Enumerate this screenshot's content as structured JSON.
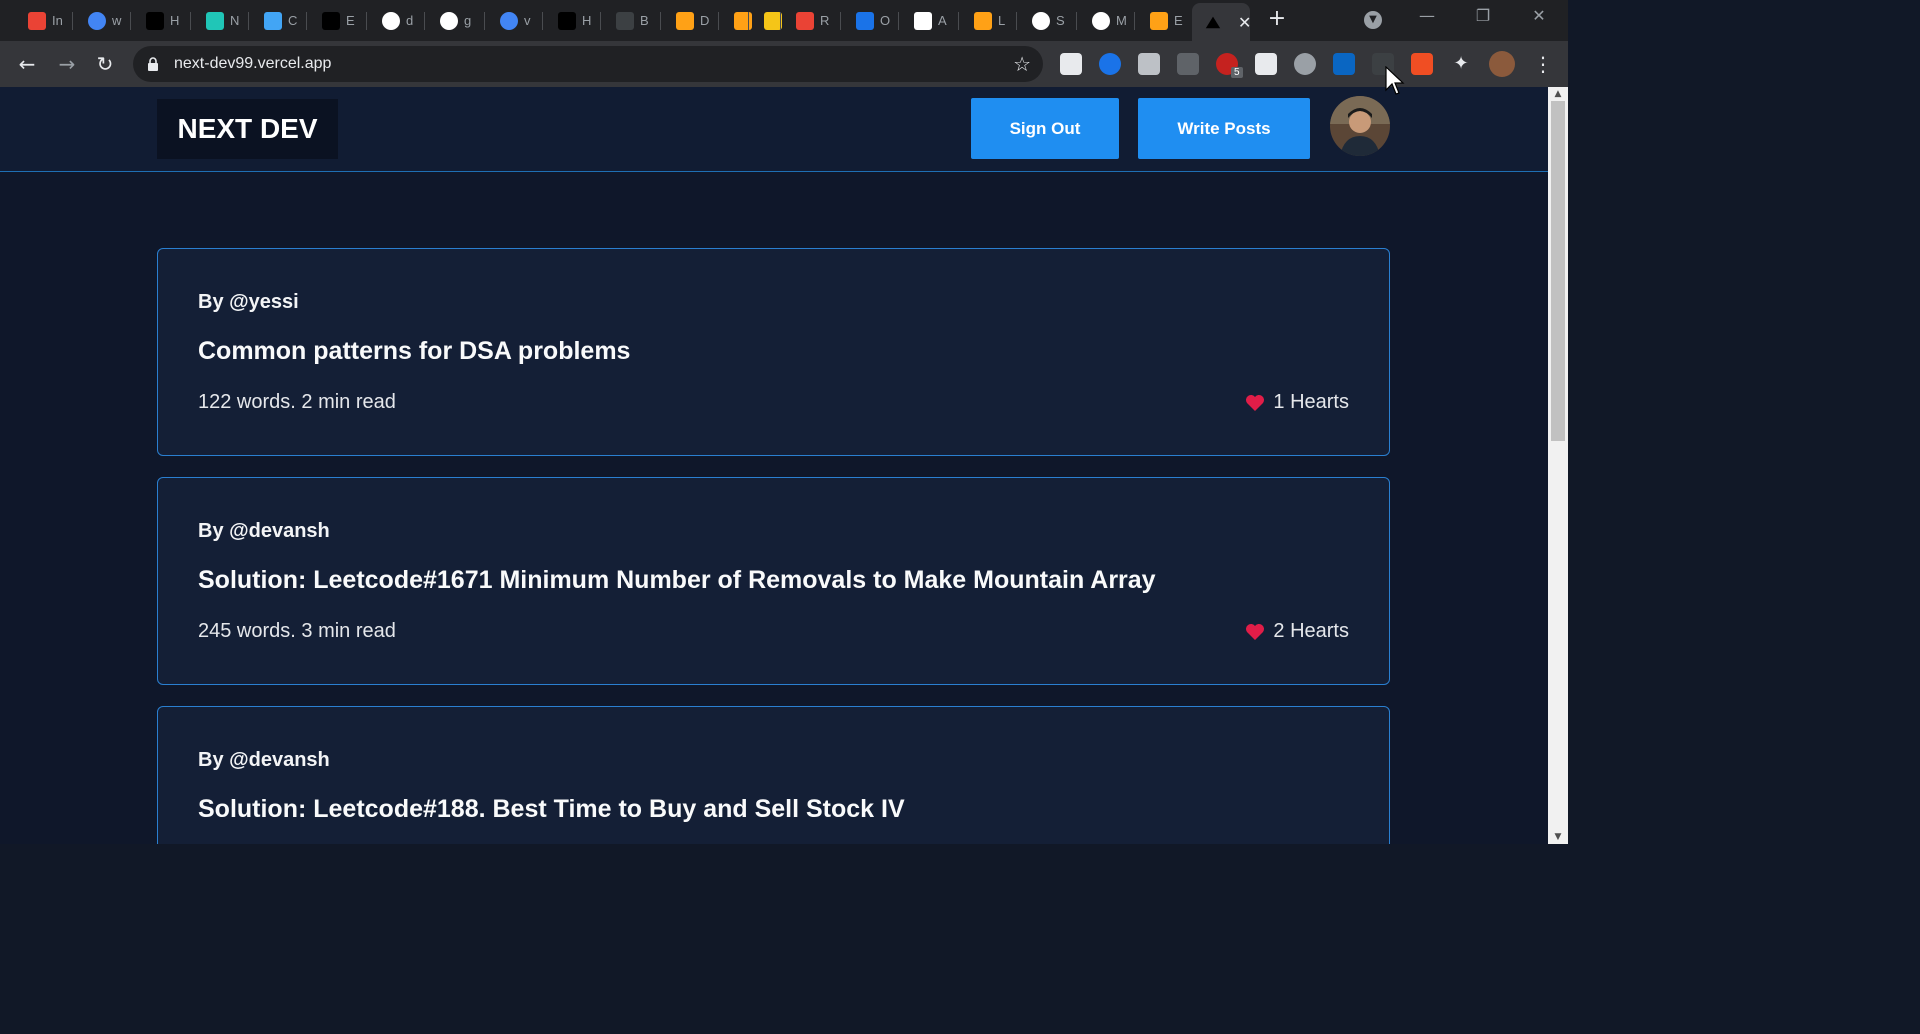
{
  "browser": {
    "tabs": [
      {
        "letter": "In",
        "icon": "gmail-icon",
        "color": "#ea4335"
      },
      {
        "letter": "w",
        "icon": "google-icon",
        "color": "#4285f4"
      },
      {
        "letter": "H",
        "icon": "vercel-icon",
        "color": "#000000"
      },
      {
        "letter": "N",
        "icon": "netlify-icon",
        "color": "#20c6b7"
      },
      {
        "letter": "C",
        "icon": "flutter-icon",
        "color": "#42a5f5"
      },
      {
        "letter": "E",
        "icon": "vercel-icon",
        "color": "#000000"
      },
      {
        "letter": "d",
        "icon": "github-icon",
        "color": "#ffffff"
      },
      {
        "letter": "g",
        "icon": "github-icon",
        "color": "#ffffff"
      },
      {
        "letter": "v",
        "icon": "google-icon",
        "color": "#4285f4"
      },
      {
        "letter": "H",
        "icon": "vercel-icon",
        "color": "#000000"
      },
      {
        "letter": "B",
        "icon": "blank-icon",
        "color": "#3c4043"
      },
      {
        "letter": "D",
        "icon": "leetcode-icon",
        "color": "#ffa116"
      },
      {
        "letter": "",
        "icon": "leetcode-icon",
        "color": "#ffa116"
      },
      {
        "letter": "",
        "icon": "yellow-icon",
        "color": "#f5c518"
      },
      {
        "letter": "R",
        "icon": "gmail-icon",
        "color": "#ea4335"
      },
      {
        "letter": "O",
        "icon": "xm-icon",
        "color": "#1a73e8"
      },
      {
        "letter": "A",
        "icon": "amazon-icon",
        "color": "#ffffff"
      },
      {
        "letter": "L",
        "icon": "leetcode-icon",
        "color": "#ffa116"
      },
      {
        "letter": "S",
        "icon": "github-icon",
        "color": "#ffffff"
      },
      {
        "letter": "M",
        "icon": "github-icon",
        "color": "#ffffff"
      },
      {
        "letter": "E",
        "icon": "leetcode-icon",
        "color": "#ffa116"
      }
    ],
    "url": "next-dev99.vercel.app",
    "extension_badge": "5"
  },
  "site": {
    "logo": "NEXT DEV",
    "sign_out": "Sign Out",
    "write_posts": "Write Posts"
  },
  "posts": [
    {
      "author": "By @yessi",
      "title": "Common patterns for DSA problems",
      "meta": "122 words. 2 min read",
      "hearts": "1 Hearts"
    },
    {
      "author": "By @devansh",
      "title": "Solution: Leetcode#1671 Minimum Number of Removals to Make Mountain Array",
      "meta": "245 words. 3 min read",
      "hearts": "2 Hearts"
    },
    {
      "author": "By @devansh",
      "title": "Solution: Leetcode#188. Best Time to Buy and Sell Stock IV",
      "meta": "",
      "hearts": ""
    }
  ],
  "colors": {
    "accent": "#1f8ef1",
    "card_border": "#2a7fd0",
    "heart": "#e11d48"
  }
}
